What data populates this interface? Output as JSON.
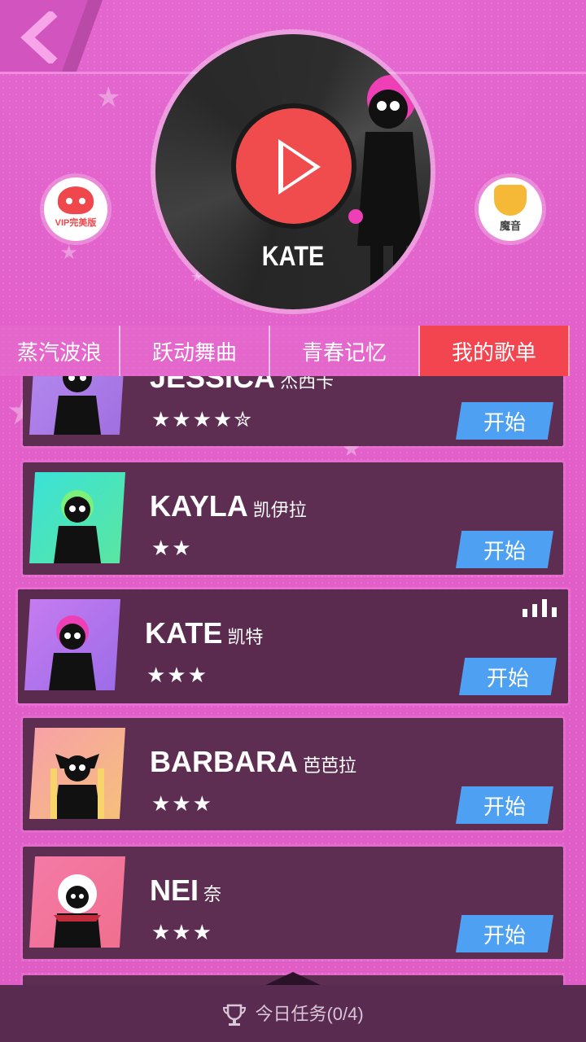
{
  "header": {
    "back_icon": "back-arrow-icon"
  },
  "side_buttons": {
    "vip_label": "VIP完美版",
    "moyin_label": "魔音"
  },
  "record": {
    "title": "KATE"
  },
  "tabs": [
    {
      "label": "蒸汽波浪",
      "active": false
    },
    {
      "label": "跃动舞曲",
      "active": false
    },
    {
      "label": "青春记忆",
      "active": false
    },
    {
      "label": "我的歌单",
      "active": true
    }
  ],
  "songs": [
    {
      "name": "JESSICA",
      "cn": "杰西卡",
      "stars": "★★★★✮",
      "action": "开始",
      "colors": [
        "#b58cf0",
        "#a06ee0"
      ]
    },
    {
      "name": "KAYLA",
      "cn": "凯伊拉",
      "stars": "★★",
      "action": "开始",
      "colors": [
        "#3ae2d8",
        "#5be6a0"
      ]
    },
    {
      "name": "KATE",
      "cn": "凯特",
      "stars": "★★★",
      "action": "开始",
      "colors": [
        "#c77cf0",
        "#9b6ce8"
      ],
      "playing": true
    },
    {
      "name": "BARBARA",
      "cn": "芭芭拉",
      "stars": "★★★",
      "action": "开始",
      "colors": [
        "#f7a0a8",
        "#f6c07a"
      ]
    },
    {
      "name": "NEI",
      "cn": "奈",
      "stars": "★★★",
      "action": "开始",
      "colors": [
        "#f47aa6",
        "#f06f8f"
      ]
    }
  ],
  "footer": {
    "task_label": "今日任务(0/4)"
  },
  "colors": {
    "accent": "#f2454f",
    "start": "#4ea1f2",
    "row_bg": "#5e2d52"
  }
}
